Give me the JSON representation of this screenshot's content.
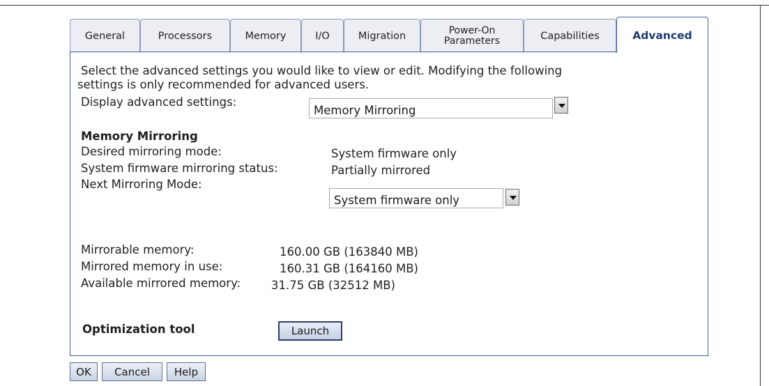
{
  "tabs": [
    {
      "label": "General"
    },
    {
      "label": "Processors"
    },
    {
      "label": "Memory"
    },
    {
      "label": "I/O"
    },
    {
      "label": "Migration"
    },
    {
      "label_line1": "Power-On",
      "label_line2": "Parameters"
    },
    {
      "label": "Capabilities"
    },
    {
      "label": "Advanced",
      "active": true
    }
  ],
  "intro": {
    "line1": "Select the advanced settings you would like to view or edit. Modifying the following",
    "line2": "settings is only recommended for advanced users."
  },
  "display_settings": {
    "label": "Display advanced settings:",
    "selected": "Memory Mirroring"
  },
  "memory_mirroring": {
    "heading": "Memory Mirroring",
    "desired_mode_label": "Desired mirroring mode:",
    "desired_mode_value": "System firmware only",
    "status_label": "System firmware mirroring status:",
    "status_value": "Partially mirrored",
    "next_mode_label": "Next Mirroring Mode:",
    "next_mode_selected": "System firmware only"
  },
  "memory_stats": {
    "mirrorable_label": "Mirrorable memory:",
    "mirrorable_value": "160.00 GB (163840 MB)",
    "in_use_label": "Mirrored memory in use:",
    "in_use_value": "160.31 GB (164160 MB)",
    "available_label": "Available mirrored memory:",
    "available_value": "31.75 GB (32512 MB)"
  },
  "optimization": {
    "label": "Optimization tool",
    "launch_label": "Launch"
  },
  "footer": {
    "ok_label": "OK",
    "cancel_label": "Cancel",
    "help_label": "Help"
  }
}
